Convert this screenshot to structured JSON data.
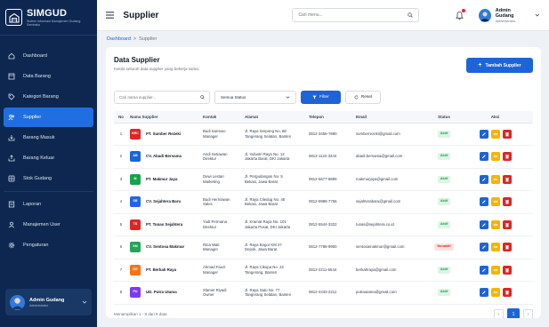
{
  "brand": {
    "name": "SIMGUD",
    "subtitle": "Sistem Informasi Manajemen Gudang Sembako"
  },
  "sidebar": {
    "items": [
      {
        "label": "Dashboard",
        "icon": "home-icon",
        "active": false
      },
      {
        "label": "Data Barang",
        "icon": "box-icon",
        "active": false
      },
      {
        "label": "Kategori Barang",
        "icon": "tag-icon",
        "active": false
      },
      {
        "label": "Supplier",
        "icon": "users-icon",
        "active": true
      },
      {
        "label": "Barang Masuk",
        "icon": "inbox-in-icon",
        "active": false
      },
      {
        "label": "Barang Keluar",
        "icon": "inbox-out-icon",
        "active": false
      },
      {
        "label": "Stok Gudang",
        "icon": "warehouse-icon",
        "active": false
      },
      {
        "label": "Laporan",
        "icon": "report-icon",
        "active": false
      },
      {
        "label": "Manajemen User",
        "icon": "user-icon",
        "active": false
      },
      {
        "label": "Pengaturan",
        "icon": "gear-icon",
        "active": false
      }
    ],
    "user": {
      "name": "Admin Gudang",
      "role": "Administrator"
    }
  },
  "header": {
    "title": "Supplier",
    "search_placeholder": "Cari menu...",
    "user": {
      "name": "Admin Gudang",
      "role": "Administrator"
    }
  },
  "breadcrumb": {
    "home": "Dashboard",
    "separator": ">",
    "current": "Supplier"
  },
  "card": {
    "title": "Data Supplier",
    "description": "Kelola seluruh data supplier yang bekerja sama.",
    "add_button": "Tambah Supplier"
  },
  "filters": {
    "search_placeholder": "Cari nama supplier...",
    "status_selected": "Semua Status",
    "filter_button": "Filter",
    "reset_button": "Reset"
  },
  "table": {
    "headers": [
      "No",
      "Nama Supplier",
      "Kontak",
      "Alamat",
      "Telepon",
      "Email",
      "Status",
      "Aksi"
    ],
    "rows": [
      {
        "no": "1",
        "logo": "BRC",
        "logo_color": "#e02424",
        "name": "PT. Sumber Rezeki",
        "contact1": "Budi Santoso",
        "contact2": "Manager",
        "addr1": "Jl. Raya Serpong No. 88",
        "addr2": "Tangerang Selatan, Banten",
        "phone": "0812-3456-7890",
        "email": "sumberrezeki@gmail.com",
        "status": "Aktif",
        "status_type": "aktif"
      },
      {
        "no": "2",
        "logo": "AB",
        "logo_color": "#1d64d8",
        "name": "CV. Abadi Bersama",
        "contact1": "Andi Setiawan",
        "contact2": "Direktur",
        "addr1": "Jl. Industri Raya No. 12",
        "addr2": "Jakarta Barat, DKI Jakarta",
        "phone": "0813-1122-3344",
        "email": "abadi.bersama@gmail.com",
        "status": "Aktif",
        "status_type": "aktif"
      },
      {
        "no": "3",
        "logo": "M",
        "logo_color": "#16a34a",
        "name": "PT. Makmur Jaya",
        "contact1": "Dewi Lestari",
        "contact2": "Marketing",
        "addr1": "Jl. Pergudangan No. 5",
        "addr2": "Bekasi, Jawa Barat",
        "phone": "0812-6677-8899",
        "email": "makmurjaya@gmail.com",
        "status": "Aktif",
        "status_type": "aktif"
      },
      {
        "no": "4",
        "logo": "SB",
        "logo_color": "#2563eb",
        "name": "CV. Sejahtera Baru",
        "contact1": "Budi Hermawan",
        "contact2": "Sales",
        "addr1": "Jl. Raya Ciledug No. 45",
        "addr2": "Bekasi, Jawa Barat",
        "phone": "0812-9988-7766",
        "email": "sejahterabaru@gmail.com",
        "status": "Aktif",
        "status_type": "aktif"
      },
      {
        "no": "5",
        "logo": "TS",
        "logo_color": "#dc2626",
        "name": "PT. Tunas Sejahtera",
        "contact1": "Yudi Permana",
        "contact2": "Direktur",
        "addr1": "Jl. Kramat Raya No. 101",
        "addr2": "Jakarta Pusat, DKI Jakarta",
        "phone": "0812-5544-3322",
        "email": "tunas@sejahtera.co.id",
        "status": "Aktif",
        "status_type": "aktif"
      },
      {
        "no": "6",
        "logo": "SM",
        "logo_color": "#22a55a",
        "name": "CV. Sentosa Makmur",
        "contact1": "Rina Wati",
        "contact2": "Manager",
        "addr1": "Jl. Raya Bogor KM 27",
        "addr2": "Depok, Jawa Barat",
        "phone": "0812-7788-9900",
        "email": "sentosamakmur@gmail.com",
        "status": "Nonaktif",
        "status_type": "nonaktif"
      },
      {
        "no": "7",
        "logo": "BR",
        "logo_color": "#f97316",
        "name": "PT. Berkah Raya",
        "contact1": "Ahmad Fauzi",
        "contact2": "Manager",
        "addr1": "Jl. Raya Cikupa No. 22",
        "addr2": "Tangerang, Banten",
        "phone": "0812-2211-5544",
        "email": "berkahraya@gmail.com",
        "status": "Aktif",
        "status_type": "aktif"
      },
      {
        "no": "8",
        "logo": "PU",
        "logo_color": "#7c3aed",
        "name": "UD. Putra Utama",
        "contact1": "Slamet Riyadi",
        "contact2": "Owner",
        "addr1": "Jl. Raya Satu No. 77",
        "addr2": "Tangerang Selatan, Banten",
        "phone": "0812-4433-2211",
        "email": "putrautama@gmail.com",
        "status": "Aktif",
        "status_type": "aktif"
      }
    ]
  },
  "footer": {
    "summary": "Menampilkan 1 - 8 dari 8 data",
    "prev": "‹",
    "page": "1",
    "next": "›"
  }
}
